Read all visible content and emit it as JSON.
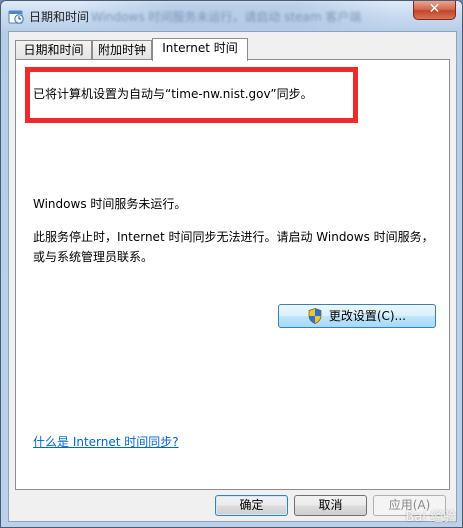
{
  "window": {
    "title": "日期和时间",
    "title_overlay": "Windows 时间服务未运行，请启动 steam 客户端",
    "close_glyph": "✕"
  },
  "tabs": [
    {
      "label": "日期和时间"
    },
    {
      "label": "附加时钟"
    },
    {
      "label": "Internet 时间"
    }
  ],
  "panel": {
    "sync_text": "已将计算机设置为自动与“time-nw.nist.gov”同步。",
    "status_text": "Windows 时间服务未运行。",
    "desc_text": "此服务停止时，Internet 时间同步无法进行。请启动 Windows 时间服务，或与系统管理员联系。",
    "change_settings_label": "更改设置(C)...",
    "help_link": "什么是 Internet 时间同步?"
  },
  "buttons": {
    "ok": "确定",
    "cancel": "取消",
    "apply": "应用(A)"
  },
  "watermark": "Bai 经验",
  "icons": {
    "title": "clock-icon",
    "shield": "uac-shield-icon"
  },
  "colors": {
    "highlight": "#ee2a2a",
    "link": "#0066cc"
  }
}
